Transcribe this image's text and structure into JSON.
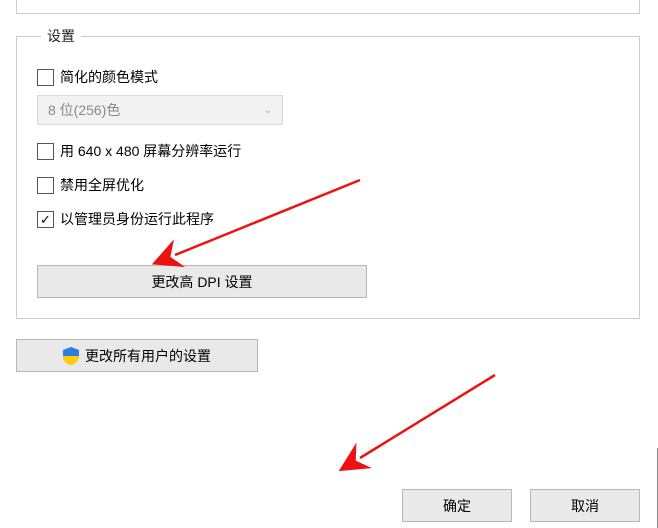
{
  "group": {
    "legend": "设置",
    "options": {
      "simplified_color_label": "简化的颜色模式",
      "simplified_color_checked": false,
      "color_depth_selected": "8 位(256)色",
      "low_res_label": "用 640 x 480 屏幕分辨率运行",
      "low_res_checked": false,
      "disable_fullscreen_label": "禁用全屏优化",
      "disable_fullscreen_checked": false,
      "run_as_admin_label": "以管理员身份运行此程序",
      "run_as_admin_checked": true
    },
    "high_dpi_button": "更改高 DPI 设置"
  },
  "all_users_button": "更改所有用户的设置",
  "footer": {
    "ok": "确定",
    "cancel": "取消"
  },
  "icons": {
    "shield": "shield-icon",
    "chevron_down": "chevron-down-icon"
  }
}
